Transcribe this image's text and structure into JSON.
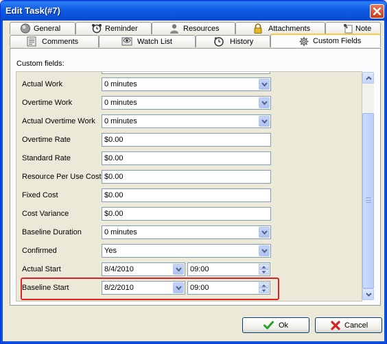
{
  "window": {
    "title": "Edit Task(#7)"
  },
  "tabs_row1": [
    {
      "label": "General",
      "icon": "globe-icon"
    },
    {
      "label": "Reminder",
      "icon": "alarm-clock-icon"
    },
    {
      "label": "Resources",
      "icon": "person-icon"
    },
    {
      "label": "Attachments",
      "icon": "padlock-icon"
    },
    {
      "label": "Note",
      "icon": "pushpin-icon"
    }
  ],
  "tabs_row2": [
    {
      "label": "Comments",
      "icon": "comments-icon"
    },
    {
      "label": "Watch List",
      "icon": "watch-list-icon"
    },
    {
      "label": "History",
      "icon": "history-icon"
    },
    {
      "label": "Custom Fields",
      "icon": "gear-icon",
      "active": true
    }
  ],
  "panel": {
    "label": "Custom fields:"
  },
  "fields": [
    {
      "label": "Actual Work",
      "value": "0 minutes",
      "kind": "dropdown"
    },
    {
      "label": "Overtime Work",
      "value": "0 minutes",
      "kind": "dropdown"
    },
    {
      "label": "Actual Overtime Work",
      "value": "0 minutes",
      "kind": "dropdown"
    },
    {
      "label": "Overtime Rate",
      "value": "$0.00",
      "kind": "text"
    },
    {
      "label": "Standard Rate",
      "value": "$0.00",
      "kind": "text"
    },
    {
      "label": "Resource Per Use Cost",
      "value": "$0.00",
      "kind": "text"
    },
    {
      "label": "Fixed Cost",
      "value": "$0.00",
      "kind": "text"
    },
    {
      "label": "Cost Variance",
      "value": "$0.00",
      "kind": "text"
    },
    {
      "label": "Baseline Duration",
      "value": "0 minutes",
      "kind": "dropdown"
    },
    {
      "label": "Confirmed",
      "value": "Yes",
      "kind": "dropdown"
    },
    {
      "label": "Actual Start",
      "date": "8/4/2010",
      "time": "09:00",
      "kind": "datetime"
    },
    {
      "label": "Baseline Start",
      "date": "8/2/2010",
      "time": "09:00",
      "kind": "datetime"
    }
  ],
  "buttons": {
    "ok": "Ok",
    "cancel": "Cancel"
  },
  "colors": {
    "title_bar": "#0a52d9",
    "highlight_box": "#e02020",
    "active_tab_accent": "#ffc83c",
    "ok_check": "#2a9d2a",
    "cancel_x": "#d42020"
  }
}
